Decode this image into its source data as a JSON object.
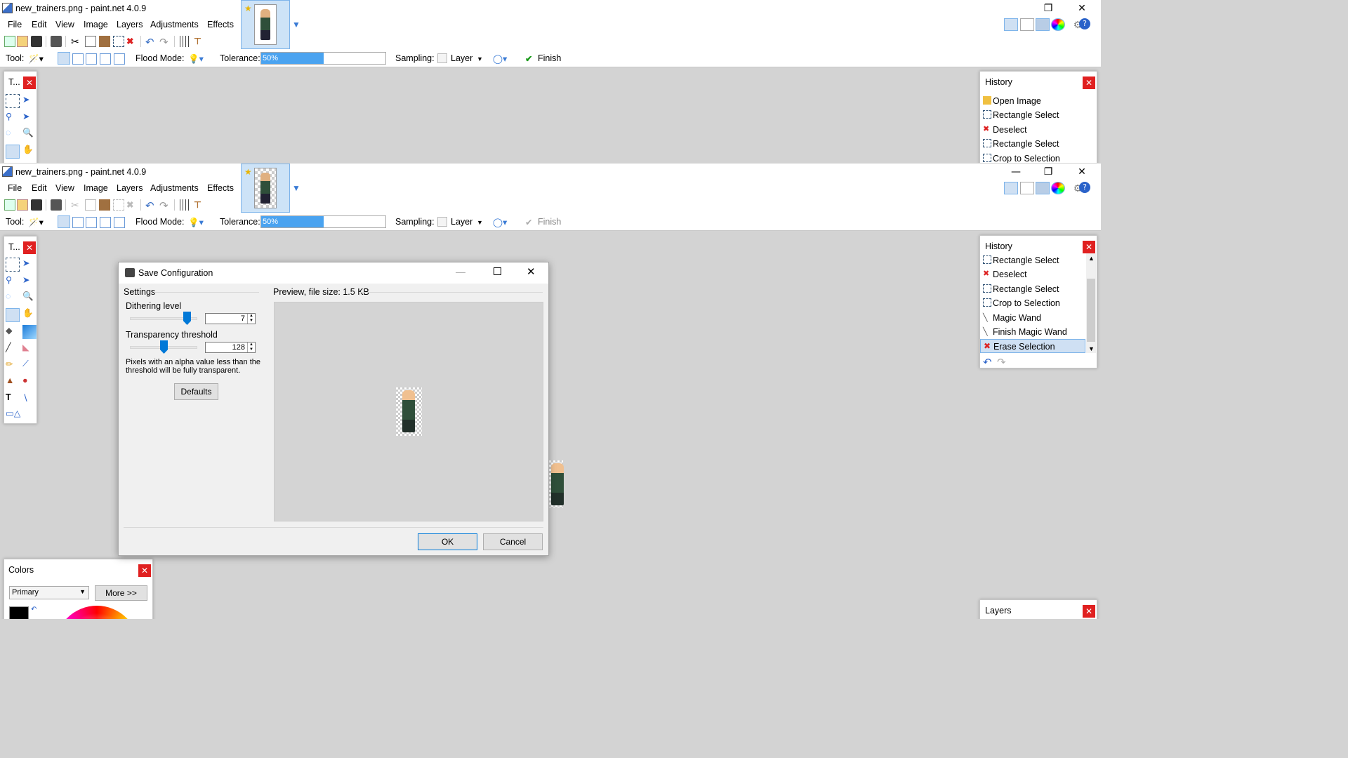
{
  "window1": {
    "title": "new_trainers.png - paint.net 4.0.9",
    "finish_label": "Finish"
  },
  "window2": {
    "title": "new_trainers.png - paint.net 4.0.9",
    "finish_label": "Finish"
  },
  "menu": [
    "File",
    "Edit",
    "View",
    "Image",
    "Layers",
    "Adjustments",
    "Effects"
  ],
  "options": {
    "tool_label": "Tool:",
    "flood_mode_label": "Flood Mode:",
    "tolerance_label": "Tolerance:",
    "tolerance_value": "50%",
    "tolerance_fraction": 0.5,
    "sampling_label": "Sampling:",
    "sampling_value": "Layer"
  },
  "tools_panel": {
    "title": "T..."
  },
  "history1": {
    "title": "History",
    "items": [
      "Open Image",
      "Rectangle Select",
      "Deselect",
      "Rectangle Select",
      "Crop to Selection"
    ]
  },
  "history2": {
    "title": "History",
    "items": [
      "Rectangle Select",
      "Deselect",
      "Rectangle Select",
      "Crop to Selection",
      "Magic Wand",
      "Finish Magic Wand",
      "Erase Selection"
    ],
    "selected": "Erase Selection"
  },
  "dialog": {
    "title": "Save Configuration",
    "settings_label": "Settings",
    "preview_label": "Preview, file size: 1.5 KB",
    "dithering_label": "Dithering level",
    "dithering_value": "7",
    "transparency_label": "Transparency threshold",
    "transparency_value": "128",
    "note": "Pixels with an alpha value less than the threshold will be fully transparent.",
    "defaults_label": "Defaults",
    "ok_label": "OK",
    "cancel_label": "Cancel"
  },
  "colors": {
    "title": "Colors",
    "mode": "Primary",
    "more_label": "More >>"
  },
  "layers": {
    "title": "Layers"
  },
  "colors_accent": {
    "selection": "#cfe0f3",
    "close": "#e02020",
    "progress": "#4aa3f0"
  }
}
